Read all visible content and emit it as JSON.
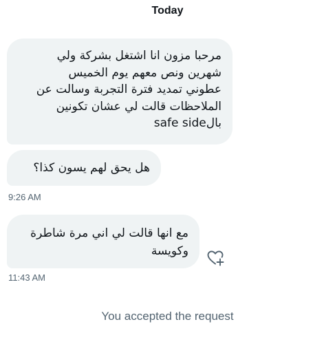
{
  "header": {
    "day_label": "Today"
  },
  "messages": [
    {
      "lines": [
        "مرحبا مزون انا اشتغل بشركة ولي",
        "شهرين ونص معهم يوم الخميس",
        "عطوني تمديد فترة التجربة وسالت عن",
        "الملاحظات قالت لي عشان تكونين",
        "بالsafe side"
      ]
    },
    {
      "lines": [
        "هل يحق لهم يسون كذا؟"
      ],
      "timestamp": "9:26 AM"
    },
    {
      "lines": [
        "مع انها قالت لي اني مرة شاطرة",
        "وكويسة"
      ],
      "timestamp": "11:43 AM",
      "reaction_icon": "heart-plus-icon"
    }
  ],
  "system_message": "You accepted the request",
  "colors": {
    "bubble_bg": "#eff3f4",
    "text": "#0f1419",
    "muted": "#536471"
  }
}
